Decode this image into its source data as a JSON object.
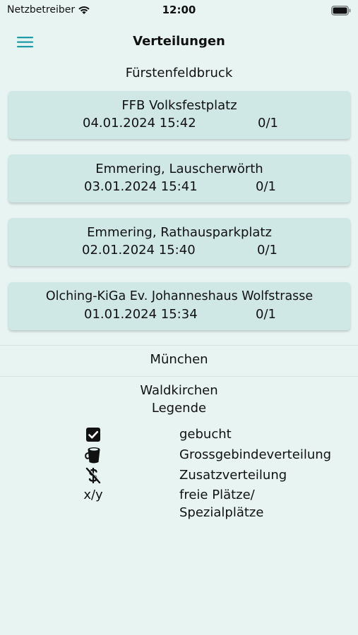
{
  "status_bar": {
    "carrier": "Netzbetreiber",
    "time": "12:00"
  },
  "header": {
    "title": "Verteilungen",
    "menu_icon": "hamburger-menu-icon"
  },
  "groups": [
    {
      "title": "Fürstenfeldbruck",
      "items": [
        {
          "name": "FFB Volksfestplatz",
          "date": "04.01.2024 15:42",
          "slots": "0/1"
        },
        {
          "name": "Emmering, Lauscherwörth",
          "date": "03.01.2024 15:41",
          "slots": "0/1"
        },
        {
          "name": "Emmering, Rathausparkplatz",
          "date": "02.01.2024 15:40",
          "slots": "0/1"
        },
        {
          "name": "Olching-KiGa Ev. Johanneshaus Wolfstrasse",
          "date": "01.01.2024 15:34",
          "slots": "0/1"
        }
      ]
    },
    {
      "title": "München",
      "items": []
    },
    {
      "title": "Waldkirchen",
      "items": []
    }
  ],
  "legend": {
    "title": "Legende",
    "entries": [
      {
        "icon": "checkbox-checked-icon",
        "label": "gebucht"
      },
      {
        "icon": "bucket-icon",
        "label": "Grossgebindeverteilung"
      },
      {
        "icon": "no-money-icon",
        "label": "Zusatzverteilung"
      },
      {
        "icon_text": "x/y",
        "label_line1": "freie Plätze/",
        "label_line2": "Spezialplätze"
      }
    ]
  }
}
